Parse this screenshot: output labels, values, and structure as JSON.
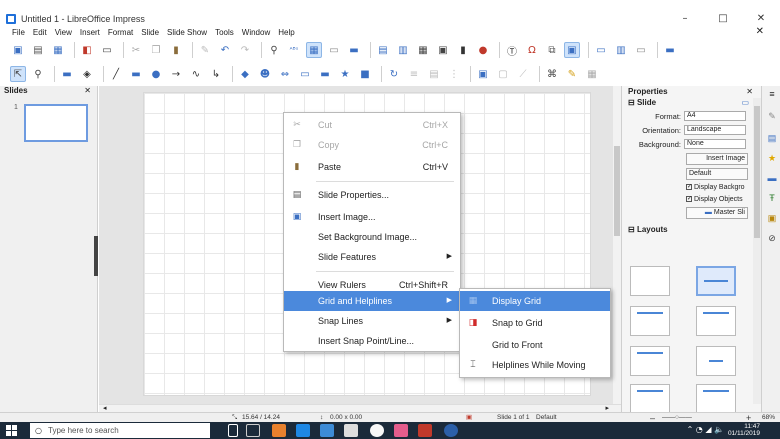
{
  "window": {
    "title": "Untitled 1 - LibreOffice Impress",
    "minimize": "–",
    "maximize": "□",
    "close": "✕"
  },
  "menubar": {
    "items": [
      "File",
      "Edit",
      "View",
      "Insert",
      "Format",
      "Slide",
      "Slide Show",
      "Tools",
      "Window",
      "Help"
    ],
    "close_doc": "✕"
  },
  "slides_panel": {
    "title": "Slides",
    "close": "✕",
    "thumb_number": "1"
  },
  "context_menu": {
    "items": [
      {
        "label": "Cut",
        "accel": "Ctrl+X",
        "icon": "cut-icon",
        "disabled": true
      },
      {
        "label": "Copy",
        "accel": "Ctrl+C",
        "icon": "copy-icon",
        "disabled": true
      },
      {
        "label": "Paste",
        "accel": "Ctrl+V",
        "icon": "paste-icon",
        "disabled": false
      },
      {
        "label": "Slide Properties...",
        "icon": "slide-properties-icon"
      },
      {
        "label": "Insert Image...",
        "icon": "insert-image-icon"
      },
      {
        "label": "Set Background Image...",
        "icon": ""
      },
      {
        "label": "Slide Features",
        "icon": "",
        "submenu": true
      },
      {
        "label": "View Rulers",
        "accel": "Ctrl+Shift+R",
        "icon": ""
      },
      {
        "label": "Grid and Helplines",
        "icon": "",
        "submenu": true,
        "highlighted": true
      },
      {
        "label": "Snap Lines",
        "icon": "",
        "submenu": true
      },
      {
        "label": "Insert Snap Point/Line...",
        "icon": ""
      }
    ]
  },
  "grid_submenu": {
    "items": [
      {
        "label": "Display Grid",
        "icon": "display-grid-icon",
        "highlighted": true
      },
      {
        "label": "Snap to Grid",
        "icon": "snap-to-grid-icon"
      },
      {
        "label": "Grid to Front",
        "icon": ""
      },
      {
        "label": "Helplines While Moving",
        "icon": "helplines-icon"
      }
    ]
  },
  "properties": {
    "title": "Properties",
    "close": "✕",
    "slide_section": "Slide",
    "format_label": "Format:",
    "format_value": "A4",
    "orientation_label": "Orientation:",
    "orientation_value": "Landscape",
    "background_label": "Background:",
    "background_value": "None",
    "insert_image_button": "Insert Image",
    "master_value": "Default",
    "display_background_label": "Display Backgro",
    "display_objects_label": "Display Objects",
    "master_slide_button": "Master Sli",
    "layouts_section": "Layouts"
  },
  "statusbar": {
    "position": "15.64 / 14.24",
    "size": "0.00 x 0.00",
    "slide_info": "Slide 1 of 1",
    "master": "Default",
    "zoom_minus": "–",
    "zoom_plus": "+",
    "zoom": "68%"
  },
  "taskbar": {
    "search_placeholder": "Type here to search",
    "time": "11:47",
    "date": "01/11/2019"
  },
  "colors": {
    "highlight": "#4b89dc",
    "accent_blue": "#1e6fd9",
    "taskbar": "#1b2a3a"
  }
}
